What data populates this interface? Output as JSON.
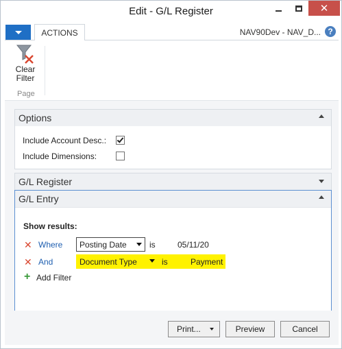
{
  "window": {
    "title": "Edit - G/L Register"
  },
  "ribbon": {
    "tab_actions": "ACTIONS",
    "company": "NAV90Dev - NAV_D...",
    "help_glyph": "?",
    "clear_filter_line1": "Clear",
    "clear_filter_line2": "Filter",
    "group_label": "Page"
  },
  "options": {
    "header": "Options",
    "include_account_desc_label": "Include Account Desc.:",
    "include_account_desc_checked": true,
    "include_dimensions_label": "Include Dimensions:",
    "include_dimensions_checked": false
  },
  "gl_register": {
    "header": "G/L Register"
  },
  "gl_entry": {
    "header": "G/L Entry",
    "show_results_label": "Show results:",
    "filters": [
      {
        "connector": "Where",
        "field": "Posting Date",
        "operator": "is",
        "value": "05/11/20"
      },
      {
        "connector": "And",
        "field": "Document Type",
        "operator": "is",
        "value": "Payment"
      }
    ],
    "add_filter_label": "Add Filter"
  },
  "footer": {
    "print_label": "Print...",
    "preview_label": "Preview",
    "cancel_label": "Cancel"
  },
  "colors": {
    "accent": "#1f6fc5",
    "close_button": "#c7504a",
    "highlight": "#fff200",
    "link": "#1f5fb0",
    "delete_x": "#d9462f",
    "add_plus": "#3a9a3a"
  }
}
